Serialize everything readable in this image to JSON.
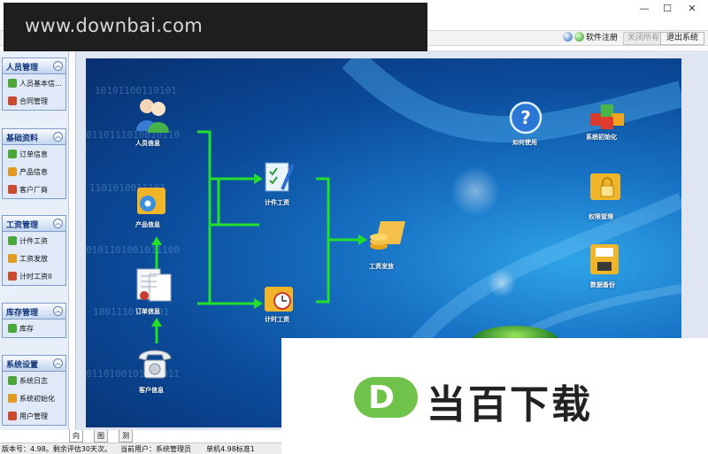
{
  "watermark": {
    "text": "www.downbai.com"
  },
  "window_controls": {
    "minimize": "—",
    "maximize": "☐",
    "close": "✕"
  },
  "toolbar": {
    "register_label": "软件注册",
    "disabled_label": "关闭所有",
    "exit_label": "退出系统"
  },
  "sidebar": {
    "groups": [
      {
        "title": "人员管理",
        "items": [
          {
            "label": "人员基本信..."
          },
          {
            "label": "合同管理"
          }
        ]
      },
      {
        "title": "基础资料",
        "items": [
          {
            "label": "订单信息"
          },
          {
            "label": "产品信息"
          },
          {
            "label": "客户厂商"
          }
        ]
      },
      {
        "title": "工资管理",
        "items": [
          {
            "label": "计件工资"
          },
          {
            "label": "工资发放"
          },
          {
            "label": "计时工资II"
          }
        ]
      },
      {
        "title": "库存管理",
        "items": [
          {
            "label": "库存"
          }
        ]
      },
      {
        "title": "系统设置",
        "items": [
          {
            "label": "系统日志"
          },
          {
            "label": "系统初始化"
          },
          {
            "label": "用户管理"
          }
        ]
      }
    ]
  },
  "flow": {
    "personnel": "人员信息",
    "product": "产品信息",
    "order": "订单信息",
    "customer": "客户信息",
    "piece_wage": "计件工资",
    "time_wage": "计时工资",
    "payroll": "工资发放",
    "help": "如何使用",
    "init": "系统初始化",
    "permission": "权限管理",
    "backup": "数据备份"
  },
  "tabs": [
    {
      "label": "向导"
    },
    {
      "label": "图标"
    },
    {
      "label": "测试模式"
    }
  ],
  "status": {
    "version": "版本号：4.98。剩余评估30天次。",
    "user": "当前用户：系统管理员",
    "edition": "单机4.98标准1"
  },
  "ad": {
    "logo_letter": "D",
    "text": "当百下载"
  },
  "colors": {
    "arrow": "#22e02a",
    "stage_dark": "#072f6e",
    "stage_light": "#2fa4e8"
  }
}
